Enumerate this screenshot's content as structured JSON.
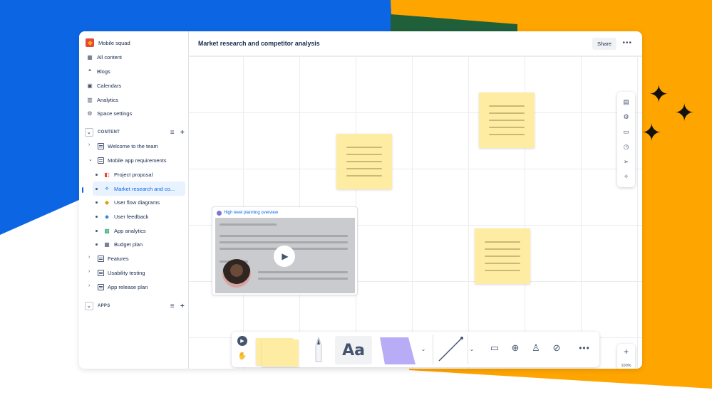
{
  "colors": {
    "blue": "#0c66e4",
    "orange": "#ffa500",
    "sticky": "#ffeca3",
    "shape": "#b8acf6"
  },
  "space": {
    "name": "Mobile squad"
  },
  "nav": [
    {
      "label": "All content",
      "icon": "grid-icon"
    },
    {
      "label": "Blogs",
      "icon": "quote-icon"
    },
    {
      "label": "Calendars",
      "icon": "calendar-icon"
    },
    {
      "label": "Analytics",
      "icon": "bar-chart-icon"
    },
    {
      "label": "Space settings",
      "icon": "gear-icon"
    }
  ],
  "content_section": {
    "label": "CONTENT"
  },
  "tree": [
    {
      "label": "Welcome to the team"
    },
    {
      "label": "Mobile app requirements"
    },
    {
      "label": "Project proposal"
    },
    {
      "label": "Market research and co..."
    },
    {
      "label": "User flow diagrams"
    },
    {
      "label": "User feedback"
    },
    {
      "label": "App analytics"
    },
    {
      "label": "Budget plan"
    },
    {
      "label": "Features"
    },
    {
      "label": "Usability testing"
    },
    {
      "label": "App release plan"
    }
  ],
  "apps_section": {
    "label": "APPS"
  },
  "header": {
    "title": "Market research and competitor analysis",
    "share": "Share",
    "more": "•••"
  },
  "loom": {
    "title": "High level planning overview"
  },
  "zoom": {
    "in": "+",
    "level": "100%",
    "out": "−"
  },
  "toolbar": {
    "text_tool": "Aa",
    "more": "•••"
  }
}
